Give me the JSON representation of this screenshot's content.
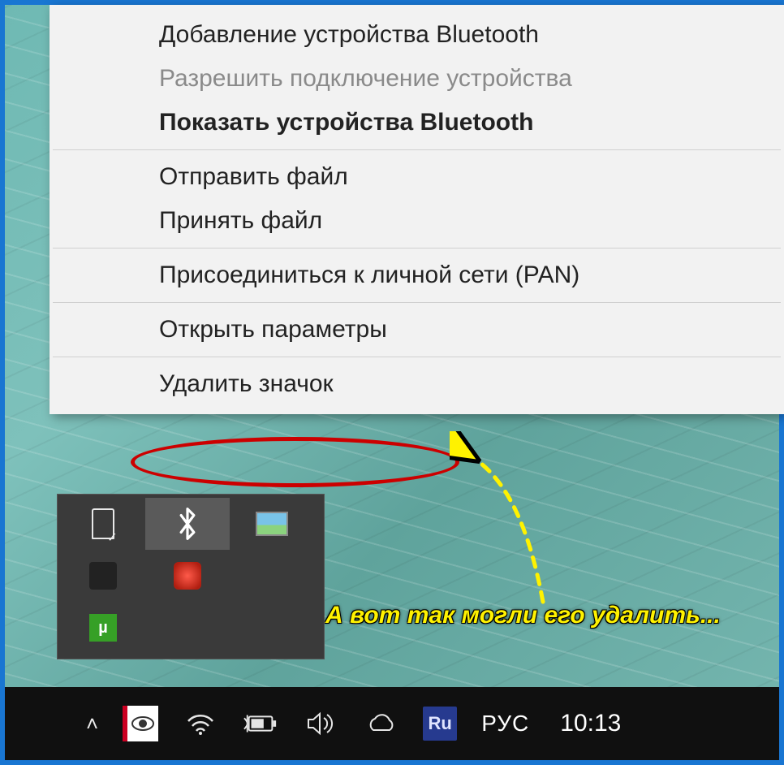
{
  "menu": {
    "items": [
      {
        "label": "Добавление устройства Bluetooth",
        "disabled": false,
        "bold": false
      },
      {
        "label": "Разрешить подключение устройства",
        "disabled": true,
        "bold": false
      },
      {
        "label": "Показать устройства Bluetooth",
        "disabled": false,
        "bold": true
      },
      {
        "label": "Отправить файл",
        "disabled": false,
        "bold": false
      },
      {
        "label": "Принять файл",
        "disabled": false,
        "bold": false
      },
      {
        "label": "Присоединиться к личной сети (PAN)",
        "disabled": false,
        "bold": false
      },
      {
        "label": "Открыть параметры",
        "disabled": false,
        "bold": false
      },
      {
        "label": "Удалить значок",
        "disabled": false,
        "bold": false
      }
    ],
    "separators_after": [
      2,
      4,
      5,
      6
    ]
  },
  "annotation": "А вот так могли его удалить...",
  "tray_popup": {
    "tiles": [
      {
        "name": "usb-eject-icon",
        "glyph": "usb"
      },
      {
        "name": "bluetooth-icon",
        "glyph": "bt",
        "selected": true
      },
      {
        "name": "pictures-icon",
        "glyph": "pic"
      },
      {
        "name": "app-icon-1",
        "glyph": "dark"
      },
      {
        "name": "recorder-icon",
        "glyph": "rec"
      },
      {
        "name": "app-icon-2",
        "glyph": "blank"
      },
      {
        "name": "utorrent-icon",
        "glyph": "utr"
      }
    ]
  },
  "taskbar": {
    "chevron": "˄",
    "ru_badge": "Ru",
    "language": "РУС",
    "time": "10:13",
    "utr_label": "µ"
  }
}
